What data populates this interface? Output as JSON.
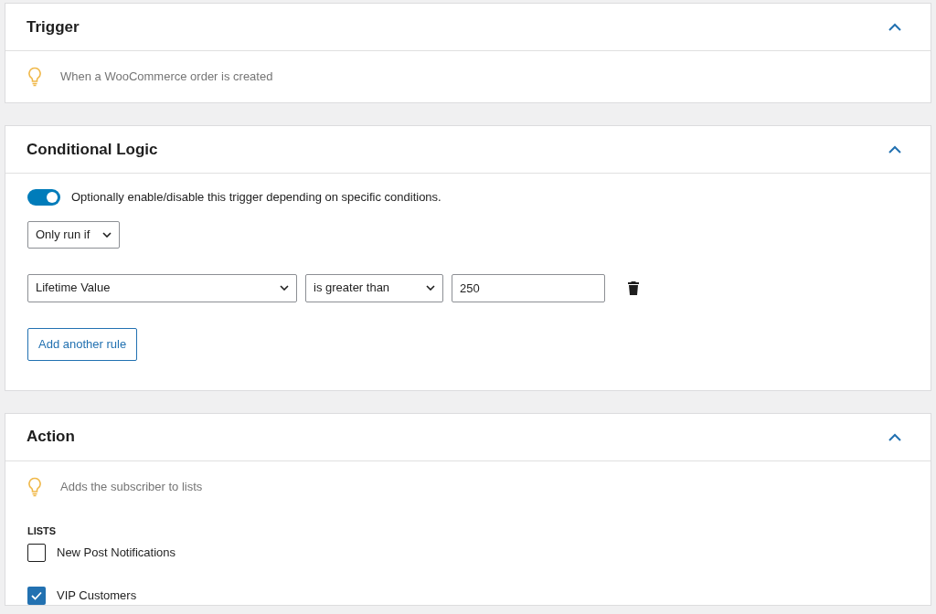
{
  "panels": [
    {
      "title": "Trigger",
      "expanded": true,
      "kind": "hint",
      "hint": "When a WooCommerce order is created"
    },
    {
      "title": "Conditional Logic",
      "expanded": true,
      "kind": "logic",
      "toggle": {
        "on": true,
        "label": "Optionally enable/disable this trigger depending on specific conditions."
      },
      "mode": "Only run if",
      "rules": [
        {
          "field": "Lifetime Value",
          "operator": "is greater than",
          "value": "250"
        }
      ],
      "add_button": "Add another rule"
    },
    {
      "title": "Action",
      "expanded": true,
      "kind": "lists",
      "hint": "Adds the subscriber to lists",
      "lists_label": "LISTS",
      "lists": [
        {
          "label": "New Post Notifications",
          "checked": false
        },
        {
          "label": "VIP Customers",
          "checked": true
        }
      ]
    }
  ]
}
